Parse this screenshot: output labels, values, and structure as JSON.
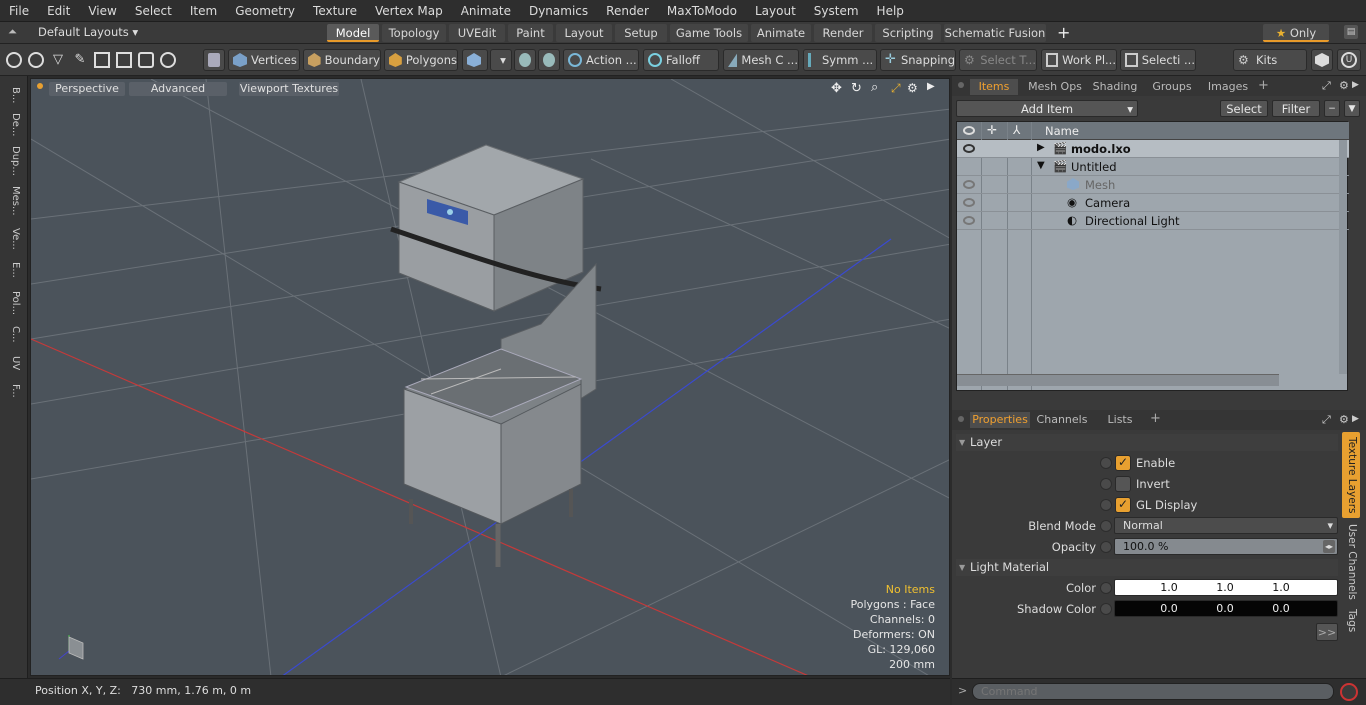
{
  "menu": [
    "File",
    "Edit",
    "View",
    "Select",
    "Item",
    "Geometry",
    "Texture",
    "Vertex Map",
    "Animate",
    "Dynamics",
    "Render",
    "MaxToModo",
    "Layout",
    "System",
    "Help"
  ],
  "layouts": {
    "label": "Default Layouts"
  },
  "tabs": [
    "Model",
    "Topology",
    "UVEdit",
    "Paint",
    "Layout",
    "Setup",
    "Game Tools",
    "Animate",
    "Render",
    "Scripting",
    "Schematic Fusion"
  ],
  "only_label": "Only",
  "toolbar": {
    "vertices": "Vertices",
    "boundary": "Boundary",
    "polygons": "Polygons",
    "action": "Action ...",
    "falloff": "Falloff",
    "meshc": "Mesh C ...",
    "symm": "Symm ...",
    "snapping": "Snapping",
    "select_t": "Select T...",
    "workpl": "Work Pl...",
    "selecti": "Selecti ...",
    "kits": "Kits"
  },
  "lefttabs": [
    "B...",
    "De...",
    "Dup...",
    "Mes...",
    "Ve...",
    "E...",
    "Pol...",
    "C...",
    "UV",
    "F..."
  ],
  "viewport": {
    "perspective": "Perspective",
    "advanced": "Advanced",
    "viewport_textures": "Viewport Textures",
    "hud": {
      "no_items": "No Items",
      "polygons": "Polygons : Face",
      "channels": "Channels: 0",
      "deformers": "Deformers: ON",
      "gl": "GL: 129,060",
      "scale": "200 mm"
    }
  },
  "status": {
    "position": "Position X, Y, Z:   730 mm, 1.76 m, 0 m"
  },
  "items_panel": {
    "tabs": [
      "Items",
      "Mesh Ops",
      "Shading",
      "Groups",
      "Images"
    ],
    "add_item": "Add Item",
    "select": "Select",
    "filter": "Filter",
    "name_header": "Name",
    "rows": [
      {
        "label": "modo.lxo"
      },
      {
        "label": "Untitled"
      },
      {
        "label": "Mesh"
      },
      {
        "label": "Camera"
      },
      {
        "label": "Directional Light"
      }
    ]
  },
  "props_panel": {
    "tabs": [
      "Properties",
      "Channels",
      "Lists"
    ],
    "layer_section": "Layer",
    "enable": "Enable",
    "invert": "Invert",
    "gl_display": "GL Display",
    "blend_mode_label": "Blend Mode",
    "blend_mode_value": "Normal",
    "opacity_label": "Opacity",
    "opacity_value": "100.0 %",
    "light_material_section": "Light Material",
    "color_label": "Color",
    "color_values": [
      "1.0",
      "1.0",
      "1.0"
    ],
    "shadow_color_label": "Shadow Color",
    "shadow_color_values": [
      "0.0",
      "0.0",
      "0.0"
    ],
    "side_tabs": [
      "Texture Layers",
      "User Channels",
      "Tags"
    ],
    "more": ">>"
  },
  "command": {
    "placeholder": "Command"
  }
}
